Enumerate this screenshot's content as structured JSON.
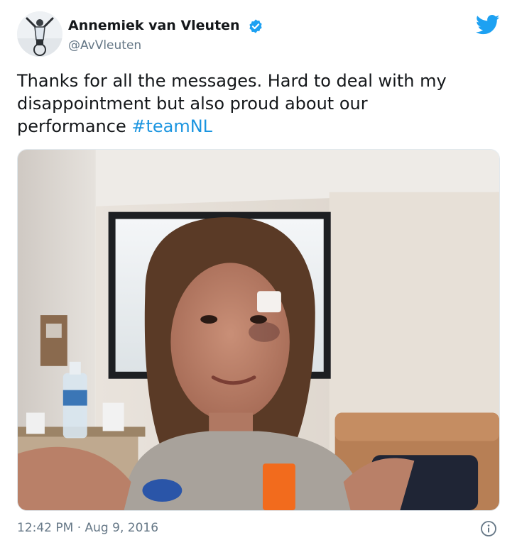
{
  "tweet": {
    "display_name": "Annemiek van Vleuten",
    "handle": "@AvVleuten",
    "verified": true,
    "text_lines": [
      "Thanks for all the messages. Hard to deal with my",
      "disappointment but also proud about our",
      "performance "
    ],
    "hashtag": "#teamNL",
    "timestamp": "12:42 PM · Aug 9, 2016"
  },
  "icons": {
    "verified": "verified-badge-icon",
    "brand": "twitter-bird-icon",
    "info": "info-icon"
  },
  "colors": {
    "accent": "#1b95e0",
    "text": "#14171a",
    "secondary": "#657786",
    "verified": "#1da1f2"
  }
}
